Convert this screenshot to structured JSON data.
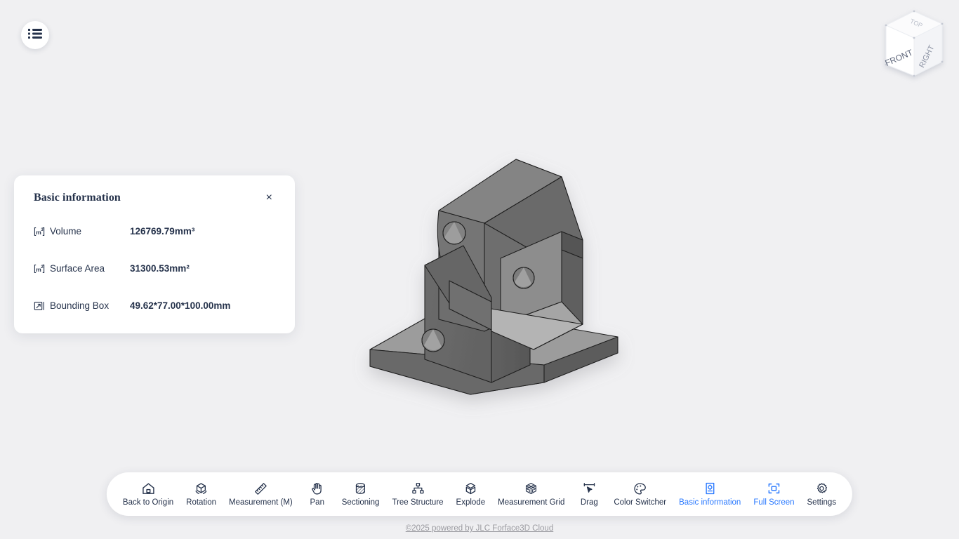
{
  "app": {
    "background_color": "#f0f0f2",
    "accent_color": "#2878ff",
    "text_color": "#25324b"
  },
  "menu_button": {
    "icon": "list-menu-icon"
  },
  "view_cube": {
    "front_label": "FRONT",
    "right_label": "RIGHT",
    "top_label": "TOP"
  },
  "model": {
    "name": "bracket-part",
    "body_color": "#6e6e6e",
    "highlight_color": "#9a9a9a",
    "shade_color": "#585858"
  },
  "info_panel": {
    "title": "Basic information",
    "close_label": "×",
    "rows": [
      {
        "icon": "volume-m3-icon",
        "label": "Volume",
        "value": "126769.79mm³"
      },
      {
        "icon": "surface-area-m2-icon",
        "label": "Surface Area",
        "value": "31300.53mm²"
      },
      {
        "icon": "bounding-box-icon",
        "label": "Bounding Box",
        "value": "49.62*77.00*100.00mm"
      }
    ]
  },
  "toolbar": {
    "items": [
      {
        "label": "Back to Origin",
        "icon": "home-icon",
        "active": false
      },
      {
        "label": "Rotation",
        "icon": "rotate-cube-icon",
        "active": false
      },
      {
        "label": "Measurement (M)",
        "icon": "ruler-icon",
        "active": false
      },
      {
        "label": "Pan",
        "icon": "hand-icon",
        "active": false
      },
      {
        "label": "Sectioning",
        "icon": "section-cylinder-icon",
        "active": false
      },
      {
        "label": "Tree Structure",
        "icon": "tree-structure-icon",
        "active": false
      },
      {
        "label": "Explode",
        "icon": "explode-cube-icon",
        "active": false
      },
      {
        "label": "Measurement Grid",
        "icon": "grid-cube-icon",
        "active": false
      },
      {
        "label": "Drag",
        "icon": "drag-cursor-icon",
        "active": false
      },
      {
        "label": "Color Switcher",
        "icon": "palette-icon",
        "active": false
      },
      {
        "label": "Basic information",
        "icon": "info-document-icon",
        "active": true
      },
      {
        "label": "Full Screen",
        "icon": "fullscreen-icon",
        "active": true
      },
      {
        "label": "Settings",
        "icon": "gear-icon",
        "active": false
      }
    ]
  },
  "footer": {
    "credit": "©2025 powered by JLC Forface3D Cloud"
  }
}
